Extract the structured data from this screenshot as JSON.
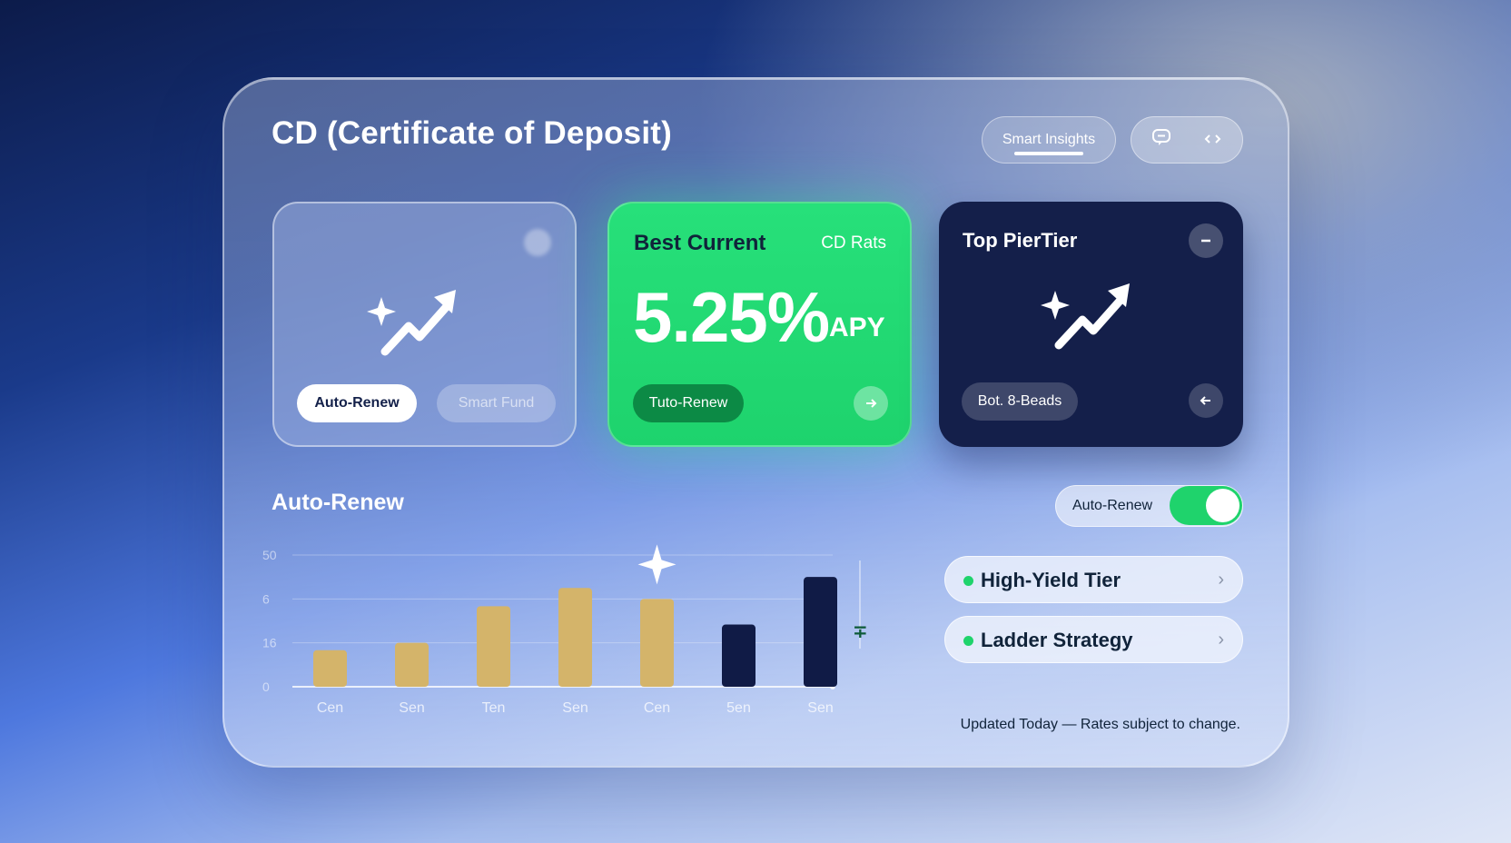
{
  "header": {
    "title": "CD (Certificate of Deposit)",
    "smart_tab_label": "Smart Insights",
    "chat_icon": "chat-bubble-icon",
    "nav_icon": "chevrons-icon"
  },
  "cards": {
    "ghost": {
      "title": "",
      "icon": "sparkle-trend-icon",
      "primary_button": "Auto-Renew",
      "secondary_button": "Smart Fund"
    },
    "best": {
      "heading": "Best Current",
      "subheading": "CD Rats",
      "rate": "5.25%",
      "rate_unit": "APY",
      "button": "Tuto-Renew",
      "action_icon": "arrow-right-icon"
    },
    "top": {
      "heading": "Top PierTier",
      "minus_icon": "minus-icon",
      "icon": "sparkle-trend-icon",
      "button": "Bot. 8-Beads",
      "back_icon": "arrow-left-icon"
    }
  },
  "section": {
    "title": "Auto-Renew",
    "toggle_label": "Auto-Renew",
    "toggle_on": true
  },
  "chart_data": {
    "type": "bar",
    "categories": [
      "Cen",
      "Sen",
      "Ten",
      "Sen",
      "Cen",
      "5en",
      "Sen"
    ],
    "values": [
      10,
      12,
      22,
      27,
      24,
      17,
      30
    ],
    "ytick_labels": [
      "50",
      "6",
      "16",
      "0"
    ],
    "ylim": [
      0,
      36
    ],
    "colors": [
      "#d4b46a",
      "#d4b46a",
      "#d4b46a",
      "#d4b46a",
      "#d4b46a",
      "#101b46",
      "#101b46"
    ],
    "highlight_index": 4,
    "grid": true
  },
  "list": [
    {
      "label": "High-Yield Tier"
    },
    {
      "label": "Ladder Strategy"
    }
  ],
  "footnote": "Updated Today — Rates subject to change.",
  "colors": {
    "accent_green": "#1fd36c",
    "navy": "#141f4a",
    "gold_bar": "#d4b46a"
  }
}
